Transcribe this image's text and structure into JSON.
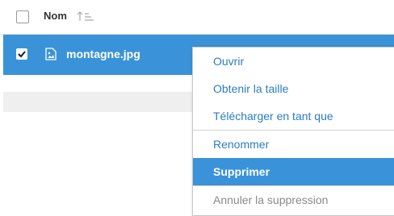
{
  "header": {
    "column_name": "Nom",
    "sort_icon": "sort-ascending-icon"
  },
  "file": {
    "name": "montagne.jpg",
    "icon": "image-file-icon",
    "selected": true
  },
  "context_menu": {
    "items": [
      {
        "label": "Ouvrir"
      },
      {
        "label": "Obtenir la taille"
      },
      {
        "label": "Télécharger en tant que"
      },
      {
        "label": "Renommer"
      },
      {
        "label": "Supprimer",
        "highlighted": true
      },
      {
        "label": "Annuler la suppression",
        "disabled": true
      }
    ]
  },
  "colors": {
    "accent": "#3a93d8",
    "menu_text": "#2b7cc1",
    "disabled_text": "#8a8a8a"
  }
}
